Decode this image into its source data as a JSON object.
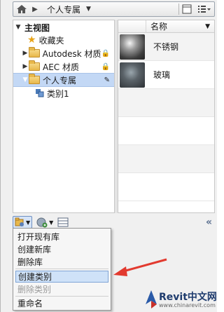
{
  "toolbar": {
    "breadcrumb": "个人专属"
  },
  "tree": {
    "root": "主视图",
    "items": [
      {
        "label": "收藏夹"
      },
      {
        "label": "Autodesk 材质"
      },
      {
        "label": "AEC 材质"
      },
      {
        "label": "个人专属"
      },
      {
        "label": "类别1"
      }
    ]
  },
  "list": {
    "column_name": "名称",
    "rows": [
      {
        "name": "不锈钢"
      },
      {
        "name": "玻璃"
      }
    ]
  },
  "menu": {
    "items": [
      {
        "label": "打开现有库"
      },
      {
        "label": "创建新库"
      },
      {
        "label": "删除库"
      },
      {
        "label": "创建类别"
      },
      {
        "label": "删除类别"
      },
      {
        "label": "重命名"
      }
    ]
  },
  "watermark": {
    "brand": "Revit中文网",
    "url": "www.chinarevit.com"
  },
  "colors": {
    "selection": "#c3d8f5",
    "menu_highlight": "#cfe2f8",
    "arrow": "#e23a2f"
  }
}
